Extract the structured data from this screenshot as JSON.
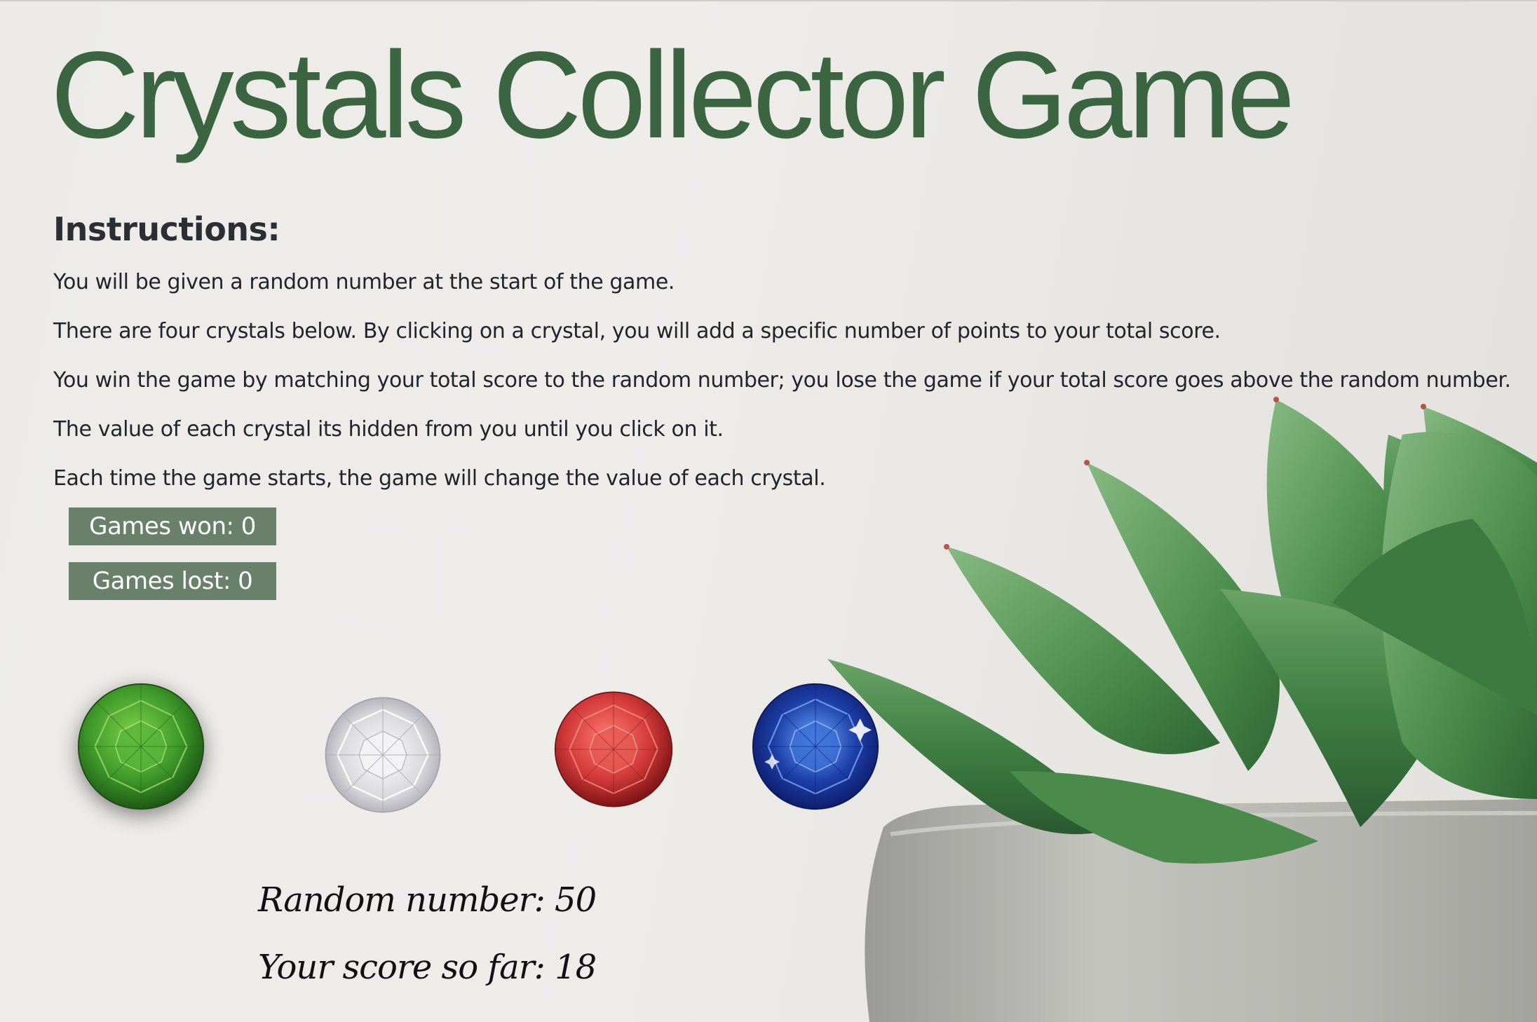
{
  "title": "Crystals Collector Game",
  "instructions": {
    "heading": "Instructions:",
    "lines": [
      "You will be given a random number at the start of the game.",
      "There are four crystals below. By clicking on a crystal, you will add a specific number of points to your total score.",
      "You win the game by matching your total score to the random number; you lose the game if your total score goes above the random number.",
      "The value of each crystal its hidden from you until you click on it.",
      "Each time the game starts, the game will change the value of each crystal."
    ]
  },
  "stats": {
    "won": "Games won: 0",
    "lost": "Games lost: 0"
  },
  "crystals": [
    {
      "name": "green",
      "color": "#3f9a2a"
    },
    {
      "name": "white",
      "color": "#e6e6ea"
    },
    {
      "name": "red",
      "color": "#d23a3a"
    },
    {
      "name": "blue",
      "color": "#1d3fa8"
    }
  ],
  "game": {
    "random_number": "Random number: 50",
    "score": "Your score so far: 18"
  },
  "colors": {
    "title": "#3b6440",
    "stat_box": "#69806a"
  }
}
